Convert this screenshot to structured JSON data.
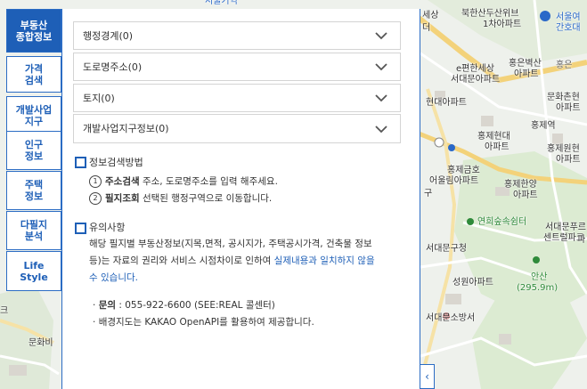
{
  "map": {
    "labels": [
      {
        "text": "서울기억",
        "cls": "blue"
      },
      {
        "text": "북한산두산위브",
        "cls": ""
      },
      {
        "text": "1차아파트",
        "cls": ""
      },
      {
        "text": "서울여",
        "cls": "blue"
      },
      {
        "text": "간호대",
        "cls": "blue"
      },
      {
        "text": "홍은벽산",
        "cls": ""
      },
      {
        "text": "아파트",
        "cls": ""
      },
      {
        "text": "e편한세상",
        "cls": ""
      },
      {
        "text": "서대문아파트",
        "cls": ""
      },
      {
        "text": "홍은",
        "cls": "gray"
      },
      {
        "text": "현대아파트",
        "cls": ""
      },
      {
        "text": "문화촌현",
        "cls": ""
      },
      {
        "text": "아파트",
        "cls": ""
      },
      {
        "text": "홍제역",
        "cls": ""
      },
      {
        "text": "홍제현대",
        "cls": ""
      },
      {
        "text": "아파트",
        "cls": ""
      },
      {
        "text": "홍제원현",
        "cls": ""
      },
      {
        "text": "아파트",
        "cls": ""
      },
      {
        "text": "홍제금호",
        "cls": ""
      },
      {
        "text": "어울림아파트",
        "cls": ""
      },
      {
        "text": "홍제한양",
        "cls": ""
      },
      {
        "text": "아파트",
        "cls": ""
      },
      {
        "text": "연희숲속쉼터",
        "cls": "green"
      },
      {
        "text": "서대문푸르",
        "cls": ""
      },
      {
        "text": "센트럴파크",
        "cls": ""
      },
      {
        "text": "서대문구청",
        "cls": ""
      },
      {
        "text": "안산",
        "cls": "green"
      },
      {
        "text": "(295.9m)",
        "cls": "green"
      },
      {
        "text": "성원아파트",
        "cls": ""
      },
      {
        "text": "서대문소방서",
        "cls": ""
      },
      {
        "text": "문화비",
        "cls": ""
      },
      {
        "text": "세상",
        "cls": ""
      },
      {
        "text": "더",
        "cls": ""
      },
      {
        "text": "구",
        "cls": ""
      },
      {
        "text": "크",
        "cls": ""
      },
      {
        "text": "파",
        "cls": ""
      }
    ]
  },
  "sidenav": {
    "items": [
      {
        "label": "부동산\n종합정보",
        "active": true
      },
      {
        "label": "가격\n검색",
        "active": false
      },
      {
        "label": "개발사업\n지구",
        "active": false
      },
      {
        "label": "인구\n정보",
        "active": false
      },
      {
        "label": "주택\n정보",
        "active": false
      },
      {
        "label": "다필지\n분석",
        "active": false
      },
      {
        "label": "Life\nStyle",
        "active": false
      }
    ]
  },
  "panel": {
    "accordions": [
      {
        "label": "행정경계(0)"
      },
      {
        "label": "도로명주소(0)"
      },
      {
        "label": "토지(0)"
      },
      {
        "label": "개발사업지구정보(0)"
      }
    ],
    "search_method": {
      "title": "정보검색방법",
      "step1_num": "1",
      "step1_bold": "주소검색",
      "step1_text": " 주소, 도로명주소를 입력 해주세요.",
      "step2_num": "2",
      "step2_bold": "필지조회",
      "step2_text": " 선택된 행정구역으로 이동합니다."
    },
    "notes": {
      "title": "유의사항",
      "line1": "해당 필지별 부동산정보(지목,면적, 공시지가, 주택공시가격, 건축물 정보",
      "line2_plain": "등)는 자료의 권리와 서비스 시점차이로 인하여 ",
      "line2_link": "실제내용과 일치하지 않을",
      "line3_link": "수 있습니다.",
      "contact_bold": "문의",
      "contact_text": " : 055-922-6600 (SEE:REAL 콜센터)",
      "basemap_text": "배경지도는 KAKAO OpenAPI를 활용하여 제공합니다."
    },
    "collapse_icon": "chevron-left-icon",
    "collapse_glyph": "‹"
  },
  "colors": {
    "accent": "#1e5fb7",
    "panel_border": "#2b6cc4"
  }
}
